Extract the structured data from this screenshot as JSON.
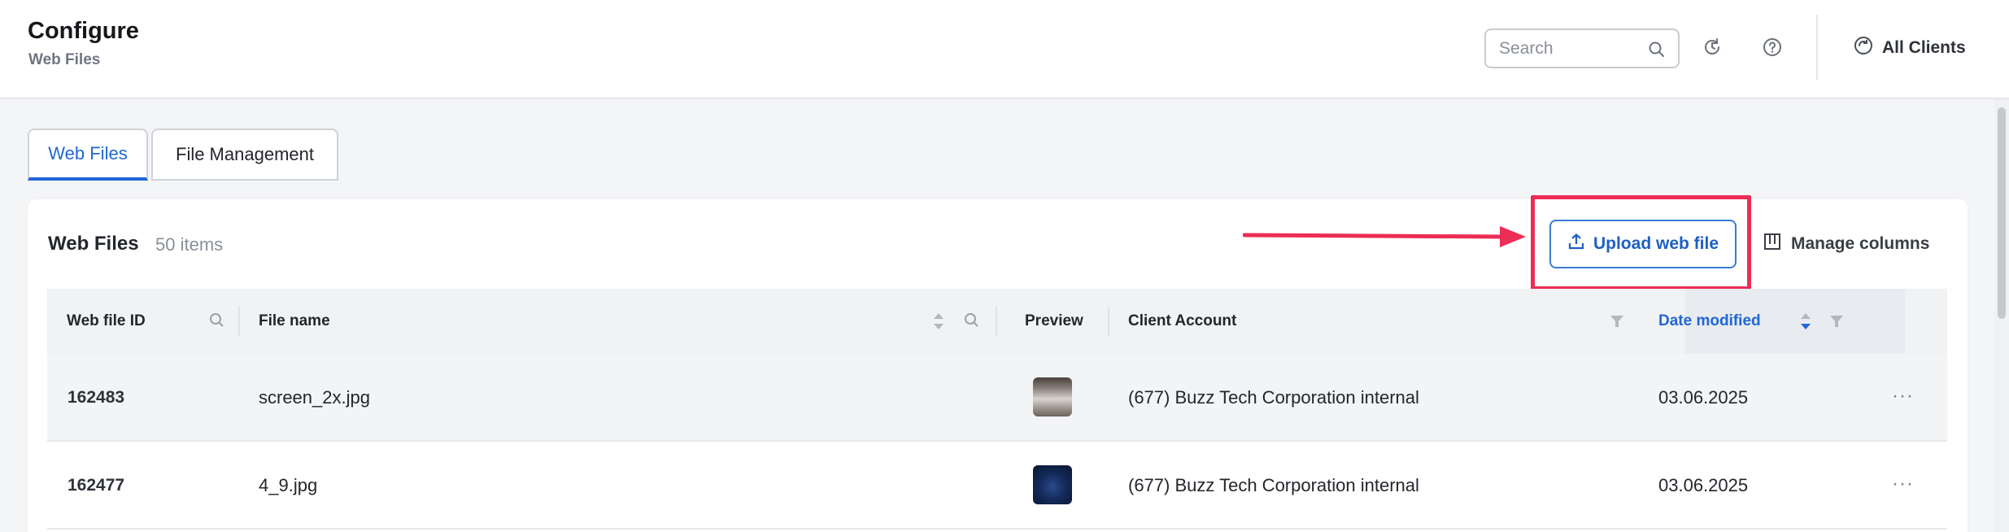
{
  "header": {
    "title": "Configure",
    "subtitle": "Web Files",
    "search_placeholder": "Search",
    "all_clients_label": "All Clients"
  },
  "tabs": [
    {
      "label": "Web Files",
      "active": true
    },
    {
      "label": "File Management",
      "active": false
    }
  ],
  "card": {
    "title": "Web Files",
    "count": "50 items",
    "upload_label": "Upload web file",
    "manage_columns_label": "Manage columns"
  },
  "table": {
    "columns": [
      "Web file ID",
      "File name",
      "Preview",
      "Client Account",
      "Date modified"
    ],
    "rows": [
      {
        "id": "162483",
        "file_name": "screen_2x.jpg",
        "client": "(677) Buzz Tech Corporation internal",
        "date": "03.06.2025",
        "more": "···"
      },
      {
        "id": "162477",
        "file_name": "4_9.jpg",
        "client": "(677) Buzz Tech Corporation internal",
        "date": "03.06.2025",
        "more": "···"
      }
    ]
  },
  "colors": {
    "accent": "#2067d6",
    "highlight": "#ec2d55"
  }
}
